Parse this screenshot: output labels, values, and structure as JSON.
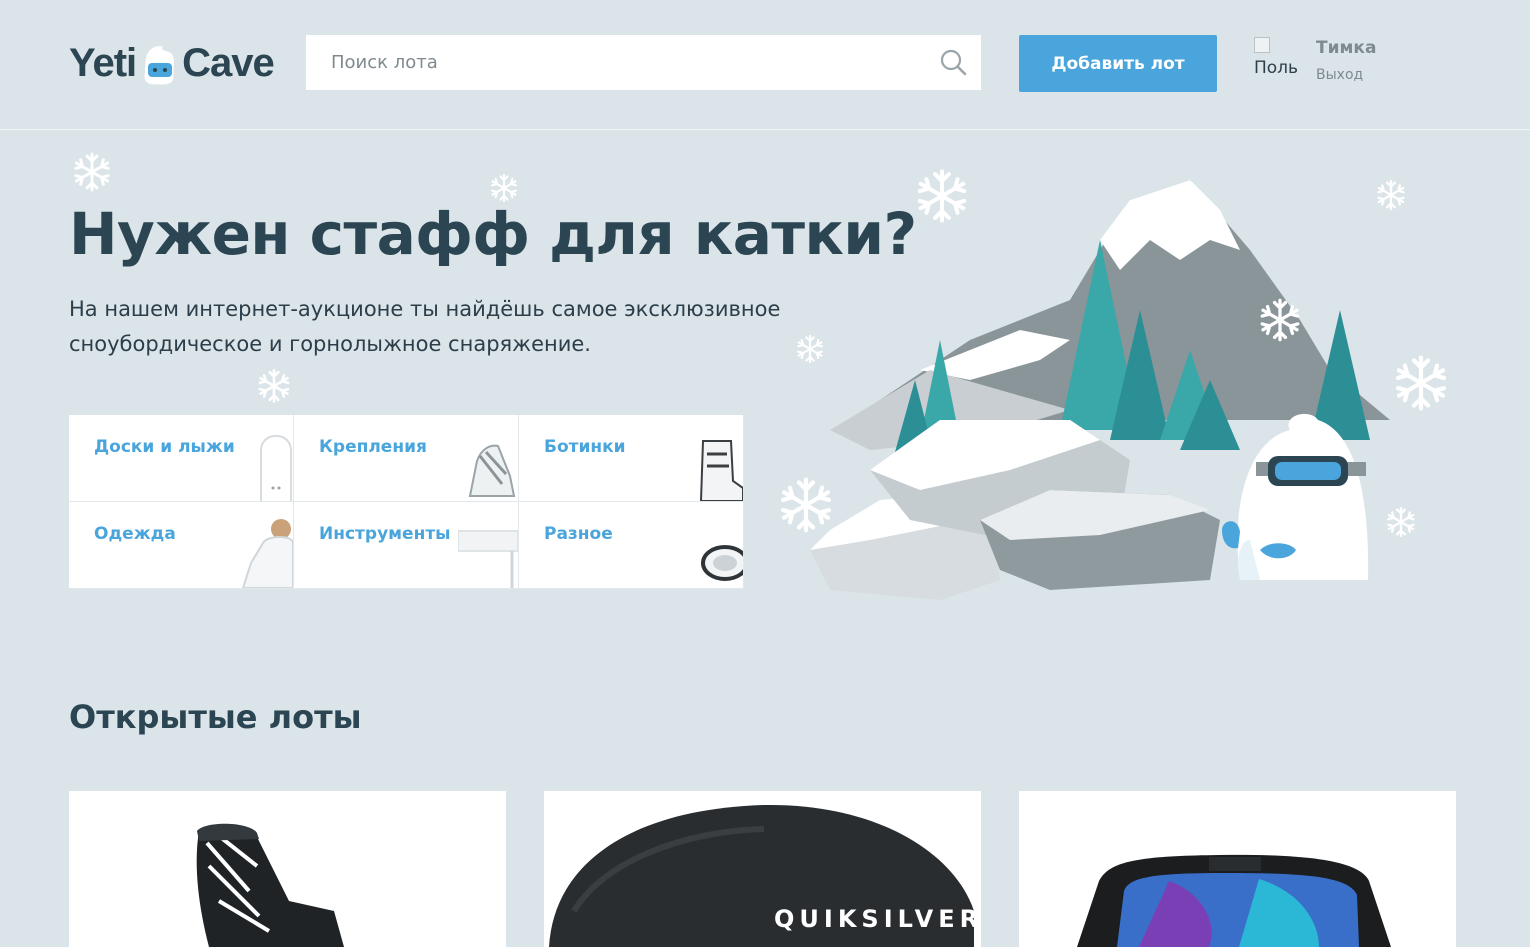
{
  "header": {
    "logo_left": "Yeti",
    "logo_right": "Cave",
    "search_placeholder": "Поиск лота",
    "add_button": "Добавить лот",
    "avatar_alt": "Поль",
    "user_name": "Тимка",
    "logout": "Выход"
  },
  "promo": {
    "title": "Нужен стафф для катки?",
    "text": "На нашем интернет-аукционе ты найдёшь самое эксклюзивное сноубордическое и горнолыжное снаряжение."
  },
  "categories": [
    {
      "label": "Доски и лыжи",
      "icon": "snowboard-icon"
    },
    {
      "label": "Крепления",
      "icon": "binding-icon"
    },
    {
      "label": "Ботинки",
      "icon": "boot-icon"
    },
    {
      "label": "Одежда",
      "icon": "jacket-icon"
    },
    {
      "label": "Инструменты",
      "icon": "tool-icon"
    },
    {
      "label": "Разное",
      "icon": "goggles-icon"
    }
  ],
  "lots": {
    "title": "Открытые лоты",
    "items": [
      {
        "image": "snowboard-binding"
      },
      {
        "image": "helmet",
        "brand_text": "QUIKSILVER"
      },
      {
        "image": "goggles"
      }
    ]
  },
  "colors": {
    "background": "#dbe4e8",
    "accent": "#4aa5dc",
    "heading": "#2c4552"
  }
}
